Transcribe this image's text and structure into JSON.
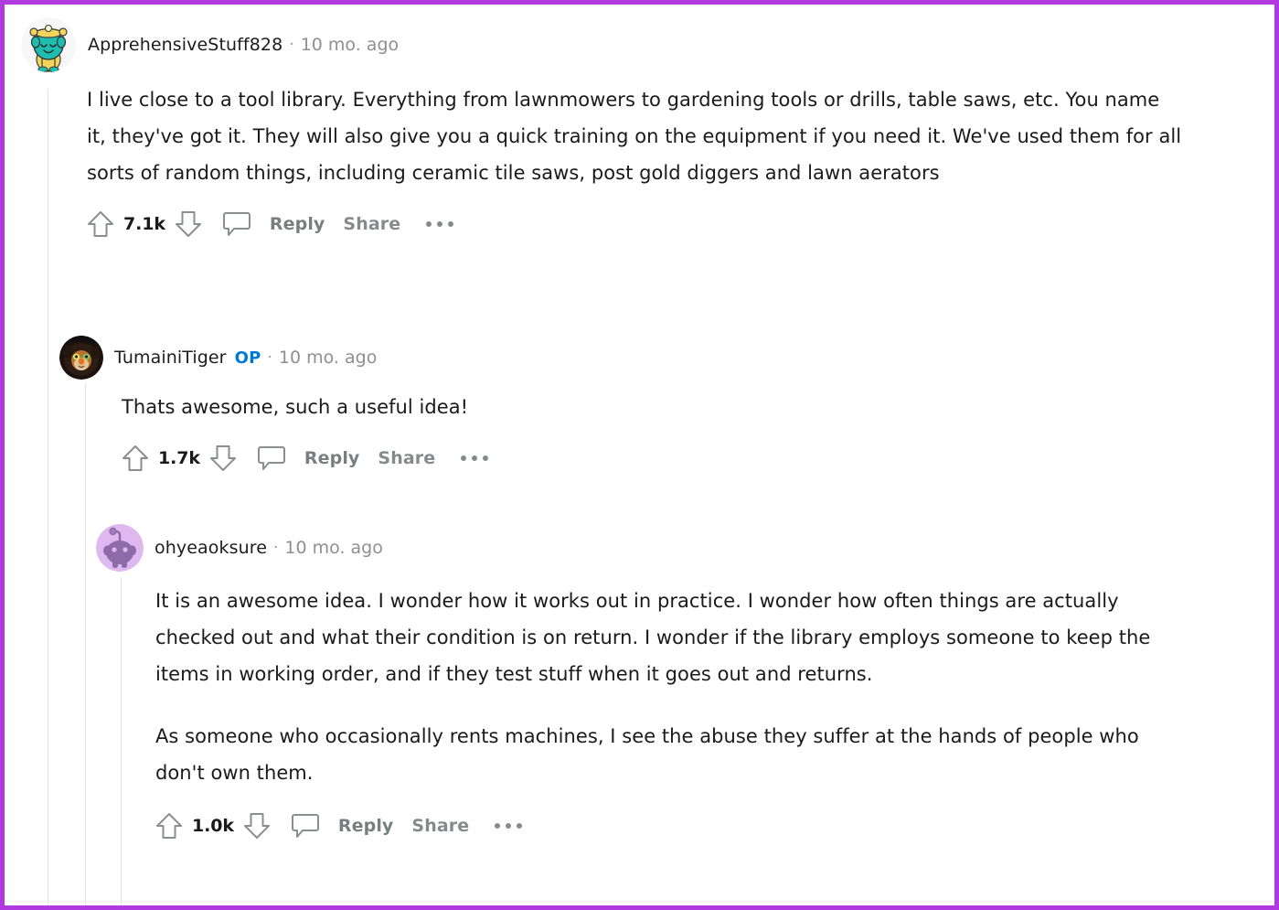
{
  "theme": {
    "page_border_color": "#b03ae0",
    "background": "#ffffff",
    "text_color": "#1a1a1b",
    "muted_color": "#878a8c",
    "op_badge_color": "#0079d3",
    "thread_line_color": "#e2e2e2"
  },
  "comments": [
    {
      "id": "comment-1",
      "username": "ApprehensiveStuff828",
      "op": false,
      "separator": "·",
      "timestamp": "10 mo. ago",
      "avatar": {
        "name": "snoo-avatar-teal",
        "body_color": "#1ebdb0",
        "accent_color": "#f2d45c",
        "background": "#f5f5f5"
      },
      "paragraphs": [
        "I live close to a tool library. Everything from lawnmowers to gardening tools or drills, table saws, etc. You name it, they've got it. They will also give you a quick training on the equipment if you need it. We've used them for all sorts of random things, including ceramic tile saws, post gold diggers and lawn aerators"
      ],
      "actions": {
        "upvote_label": "upvote",
        "score": "7.1k",
        "downvote_label": "downvote",
        "comment_label": "comments",
        "reply": "Reply",
        "share": "Share",
        "more": "more options"
      }
    },
    {
      "id": "comment-2",
      "username": "TumainiTiger",
      "op": true,
      "op_label": "OP",
      "separator": "·",
      "timestamp": "10 mo. ago",
      "avatar": {
        "name": "lion-photo-avatar",
        "body_color": "#2b1d14",
        "accent_color": "#e08a2e",
        "background": "#1a120b"
      },
      "paragraphs": [
        "Thats awesome, such a useful idea!"
      ],
      "actions": {
        "upvote_label": "upvote",
        "score": "1.7k",
        "downvote_label": "downvote",
        "comment_label": "comments",
        "reply": "Reply",
        "share": "Share",
        "more": "more options"
      }
    },
    {
      "id": "comment-3",
      "username": "ohyeaoksure",
      "op": false,
      "separator": "·",
      "timestamp": "10 mo. ago",
      "avatar": {
        "name": "snoo-avatar-purple",
        "body_color": "#8d6ba8",
        "accent_color": "#9f7cbd",
        "background": "#e0b8f0"
      },
      "paragraphs": [
        "It is an awesome idea. I wonder how it works out in practice. I wonder how often things are actually checked out and what their condition is on return. I wonder if the library employs someone to keep the items in working order, and if they test stuff when it goes out and returns.",
        "As someone who occasionally rents machines, I see the abuse they suffer at the hands of people who don't own them."
      ],
      "actions": {
        "upvote_label": "upvote",
        "score": "1.0k",
        "downvote_label": "downvote",
        "comment_label": "comments",
        "reply": "Reply",
        "share": "Share",
        "more": "more options"
      }
    }
  ]
}
